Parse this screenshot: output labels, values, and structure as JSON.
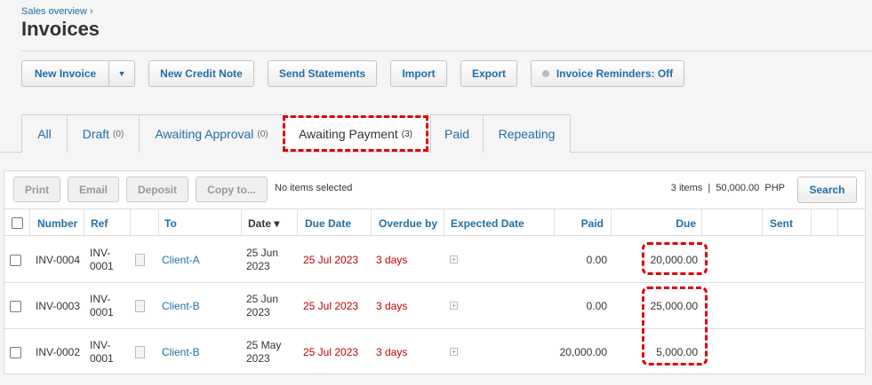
{
  "breadcrumb": "Sales overview ›",
  "page_title": "Invoices",
  "actions": {
    "new_invoice": "New Invoice",
    "new_credit_note": "New Credit Note",
    "send_statements": "Send Statements",
    "import": "Import",
    "export": "Export",
    "invoice_reminders": "Invoice Reminders: Off"
  },
  "tabs": [
    {
      "label": "All",
      "count": ""
    },
    {
      "label": "Draft",
      "count": "(0)"
    },
    {
      "label": "Awaiting Approval",
      "count": "(0)"
    },
    {
      "label": "Awaiting Payment",
      "count": "(3)"
    },
    {
      "label": "Paid",
      "count": ""
    },
    {
      "label": "Repeating",
      "count": ""
    }
  ],
  "toolbar": {
    "print": "Print",
    "email": "Email",
    "deposit": "Deposit",
    "copy_to": "Copy to...",
    "selection": "No items selected",
    "summary": "3 items  |  50,000.00  PHP",
    "search": "Search"
  },
  "columns": {
    "number": "Number",
    "ref": "Ref",
    "to": "To",
    "date": "Date ▾",
    "due_date": "Due Date",
    "overdue_by": "Overdue by",
    "expected_date": "Expected Date",
    "paid": "Paid",
    "due": "Due",
    "sent": "Sent"
  },
  "rows": [
    {
      "number": "INV-0004",
      "ref": "INV-0001",
      "to": "Client-A",
      "date": "25 Jun 2023",
      "due_date": "25 Jul 2023",
      "overdue_by": "3 days",
      "paid": "0.00",
      "due": "20,000.00"
    },
    {
      "number": "INV-0003",
      "ref": "INV-0001",
      "to": "Client-B",
      "date": "25 Jun 2023",
      "due_date": "25 Jul 2023",
      "overdue_by": "3 days",
      "paid": "0.00",
      "due": "25,000.00"
    },
    {
      "number": "INV-0002",
      "ref": "INV-0001",
      "to": "Client-B",
      "date": "25 May 2023",
      "due_date": "25 Jul 2023",
      "overdue_by": "3 days",
      "paid": "20,000.00",
      "due": "5,000.00"
    }
  ],
  "colors": {
    "accent": "#1f6ea8",
    "overdue": "#c00000",
    "highlight": "#e00000"
  }
}
